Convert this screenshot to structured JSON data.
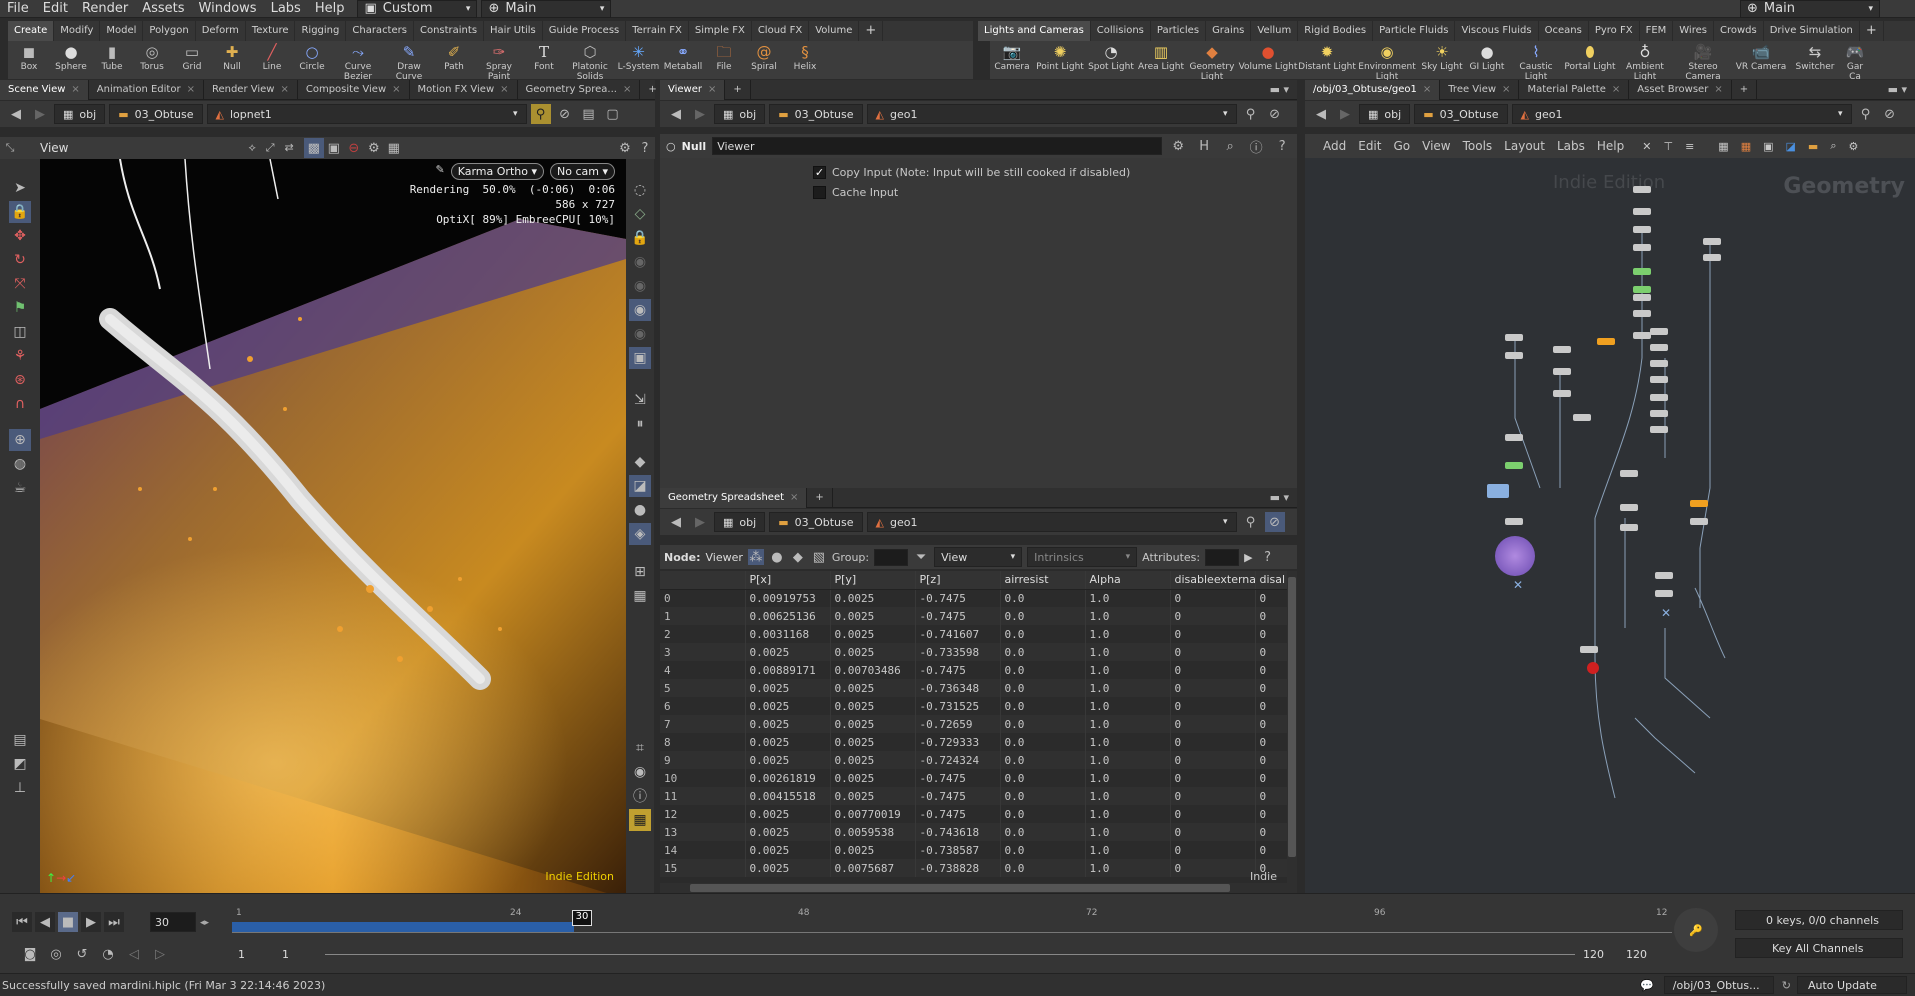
{
  "menubar": {
    "items": [
      "File",
      "Edit",
      "Render",
      "Assets",
      "Windows",
      "Labs",
      "Help"
    ],
    "desktop": "Custom",
    "context": "Main",
    "right_context": "Main"
  },
  "shelf_left": {
    "tabs": [
      "Create",
      "Modify",
      "Model",
      "Polygon",
      "Deform",
      "Texture",
      "Rigging",
      "Characters",
      "Constraints",
      "Hair Utils",
      "Guide Process",
      "Terrain FX",
      "Simple FX",
      "Cloud FX",
      "Volume"
    ],
    "tools": [
      {
        "label": "Box",
        "icon": "box-icon"
      },
      {
        "label": "Sphere",
        "icon": "sphere-icon"
      },
      {
        "label": "Tube",
        "icon": "tube-icon"
      },
      {
        "label": "Torus",
        "icon": "torus-icon"
      },
      {
        "label": "Grid",
        "icon": "grid-icon"
      },
      {
        "label": "Null",
        "icon": "null-icon"
      },
      {
        "label": "Line",
        "icon": "line-icon"
      },
      {
        "label": "Circle",
        "icon": "circle-icon"
      },
      {
        "label": "Curve Bezier",
        "icon": "curve-bezier-icon"
      },
      {
        "label": "Draw Curve",
        "icon": "draw-curve-icon"
      },
      {
        "label": "Path",
        "icon": "path-icon"
      },
      {
        "label": "Spray Paint",
        "icon": "spray-paint-icon"
      },
      {
        "label": "Font",
        "icon": "font-icon"
      },
      {
        "label": "Platonic Solids",
        "icon": "platonic-icon"
      },
      {
        "label": "L-System",
        "icon": "lsystem-icon"
      },
      {
        "label": "Metaball",
        "icon": "metaball-icon"
      },
      {
        "label": "File",
        "icon": "file-icon"
      },
      {
        "label": "Spiral",
        "icon": "spiral-icon"
      },
      {
        "label": "Helix",
        "icon": "helix-icon"
      }
    ]
  },
  "shelf_right": {
    "tabs": [
      "Lights and Cameras",
      "Collisions",
      "Particles",
      "Grains",
      "Vellum",
      "Rigid Bodies",
      "Particle Fluids",
      "Viscous Fluids",
      "Oceans",
      "Pyro FX",
      "FEM",
      "Wires",
      "Crowds",
      "Drive Simulation"
    ],
    "tools": [
      {
        "label": "Camera",
        "icon": "camera-icon"
      },
      {
        "label": "Point Light",
        "icon": "point-light-icon"
      },
      {
        "label": "Spot Light",
        "icon": "spot-light-icon"
      },
      {
        "label": "Area Light",
        "icon": "area-light-icon"
      },
      {
        "label": "Geometry Light",
        "icon": "geometry-light-icon"
      },
      {
        "label": "Volume Light",
        "icon": "volume-light-icon"
      },
      {
        "label": "Distant Light",
        "icon": "distant-light-icon"
      },
      {
        "label": "Environment Light",
        "icon": "environment-light-icon"
      },
      {
        "label": "Sky Light",
        "icon": "sky-light-icon"
      },
      {
        "label": "GI Light",
        "icon": "gi-light-icon"
      },
      {
        "label": "Caustic Light",
        "icon": "caustic-light-icon"
      },
      {
        "label": "Portal Light",
        "icon": "portal-light-icon"
      },
      {
        "label": "Ambient Light",
        "icon": "ambient-light-icon"
      },
      {
        "label": "Stereo Camera",
        "icon": "stereo-camera-icon"
      },
      {
        "label": "VR Camera",
        "icon": "vr-camera-icon"
      },
      {
        "label": "Switcher",
        "icon": "switcher-icon"
      },
      {
        "label": "Gar Ca",
        "icon": "gamepad-camera-icon"
      }
    ]
  },
  "left_pane": {
    "tabs": [
      "Scene View",
      "Animation Editor",
      "Render View",
      "Composite View",
      "Motion FX View",
      "Geometry Sprea..."
    ],
    "path": [
      "obj",
      "03_Obtuse",
      "lopnet1"
    ],
    "view_label": "View",
    "renderer": "Karma Ortho",
    "camera": "No cam",
    "stats": {
      "line1": "Rendering  50.0%  (-0:06)  0:06",
      "line2": "586 x 727",
      "line3": "OptiX[ 89%] EmbreeCPU[ 10%]"
    },
    "watermark": "Indie Edition"
  },
  "mid_top": {
    "tabs": [
      "Viewer"
    ],
    "path": [
      "obj",
      "03_Obtuse",
      "geo1"
    ],
    "node_type": "Null",
    "node_name": "Viewer",
    "params": [
      {
        "label": "Copy Input (Note: Input will be still cooked if disabled)",
        "checked": true
      },
      {
        "label": "Cache Input",
        "checked": false
      }
    ]
  },
  "spreadsheet": {
    "tab": "Geometry Spreadsheet",
    "path": [
      "obj",
      "03_Obtuse",
      "geo1"
    ],
    "node_label": "Node:",
    "node_name": "Viewer",
    "group_label": "Group:",
    "view_label": "View",
    "intrinsics_label": "Intrinsics",
    "attributes_label": "Attributes:",
    "watermark": "Indie",
    "columns": [
      "",
      "P[x]",
      "P[y]",
      "P[z]",
      "airresist",
      "Alpha",
      "disableexternal",
      "disal"
    ],
    "rows": [
      [
        "0",
        "0.00919753",
        "0.0025",
        "-0.7475",
        "0.0",
        "1.0",
        "0",
        "0"
      ],
      [
        "1",
        "0.00625136",
        "0.0025",
        "-0.7475",
        "0.0",
        "1.0",
        "0",
        "0"
      ],
      [
        "2",
        "0.0031168",
        "0.0025",
        "-0.741607",
        "0.0",
        "1.0",
        "0",
        "0"
      ],
      [
        "3",
        "0.0025",
        "0.0025",
        "-0.733598",
        "0.0",
        "1.0",
        "0",
        "0"
      ],
      [
        "4",
        "0.00889171",
        "0.00703486",
        "-0.7475",
        "0.0",
        "1.0",
        "0",
        "0"
      ],
      [
        "5",
        "0.0025",
        "0.0025",
        "-0.736348",
        "0.0",
        "1.0",
        "0",
        "0"
      ],
      [
        "6",
        "0.0025",
        "0.0025",
        "-0.731525",
        "0.0",
        "1.0",
        "0",
        "0"
      ],
      [
        "7",
        "0.0025",
        "0.0025",
        "-0.72659",
        "0.0",
        "1.0",
        "0",
        "0"
      ],
      [
        "8",
        "0.0025",
        "0.0025",
        "-0.729333",
        "0.0",
        "1.0",
        "0",
        "0"
      ],
      [
        "9",
        "0.0025",
        "0.0025",
        "-0.724324",
        "0.0",
        "1.0",
        "0",
        "0"
      ],
      [
        "10",
        "0.00261819",
        "0.0025",
        "-0.7475",
        "0.0",
        "1.0",
        "0",
        "0"
      ],
      [
        "11",
        "0.00415518",
        "0.0025",
        "-0.7475",
        "0.0",
        "1.0",
        "0",
        "0"
      ],
      [
        "12",
        "0.0025",
        "0.00770019",
        "-0.7475",
        "0.0",
        "1.0",
        "0",
        "0"
      ],
      [
        "13",
        "0.0025",
        "0.0059538",
        "-0.743618",
        "0.0",
        "1.0",
        "0",
        "0"
      ],
      [
        "14",
        "0.0025",
        "0.0025",
        "-0.738587",
        "0.0",
        "1.0",
        "0",
        "0"
      ],
      [
        "15",
        "0.0025",
        "0.0075687",
        "-0.738828",
        "0.0",
        "1.0",
        "0",
        "0"
      ]
    ]
  },
  "network": {
    "tabs": [
      "/obj/03_Obtuse/geo1",
      "Tree View",
      "Material Palette",
      "Asset Browser"
    ],
    "path": [
      "obj",
      "03_Obtuse",
      "geo1"
    ],
    "menu": [
      "Add",
      "Edit",
      "Go",
      "View",
      "Tools",
      "Layout",
      "Labs",
      "Help"
    ],
    "watermark": "Indie Edition",
    "context_label": "Geometry"
  },
  "timeline": {
    "current_frame": "30",
    "ticks": [
      "1",
      "24",
      "48",
      "72",
      "96",
      "12"
    ],
    "marker": "30",
    "start": "1",
    "range_start": "1",
    "range_end": "120",
    "end": "120",
    "keys": "0 keys, 0/0 channels",
    "channels": "Key All Channels"
  },
  "status": {
    "message": "Successfully saved mardini.hiplc (Fri Mar  3 22:14:46 2023)",
    "path": "/obj/03_Obtus...",
    "update": "Auto Update"
  }
}
